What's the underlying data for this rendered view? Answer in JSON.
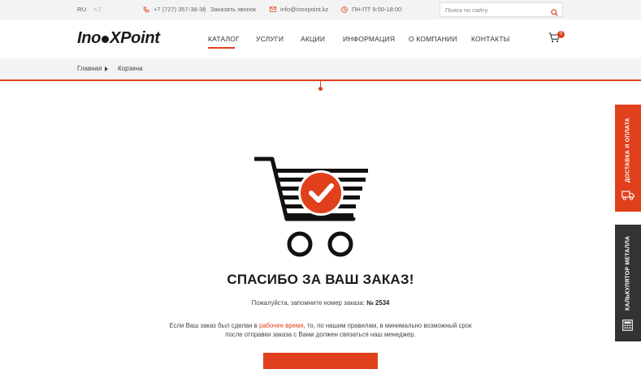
{
  "topbar": {
    "lang_current": "RU",
    "lang_other": "KZ",
    "phone": "+7 (727) 357-38-38",
    "callback": "Заказать звонок",
    "email": "info@inoxpoint.kz",
    "hours": "ПН-ПТ  9:00-18:00",
    "search_placeholder": "Поиск по сайту"
  },
  "header": {
    "logo_text_left": "Ino",
    "logo_text_right": "XPoint",
    "nav": [
      "КАТАЛОГ",
      "УСЛУГИ",
      "АКЦИИ",
      "ИНФОРМАЦИЯ",
      "О КОМПАНИИ",
      "КОНТАКТЫ"
    ],
    "active_nav_index": 0,
    "cart_count": "0"
  },
  "breadcrumb": {
    "home": "Главная",
    "current": "Корзина"
  },
  "main": {
    "title": "СПАСИБО ЗА ВАШ ЗАКАЗ!",
    "order_prefix": "Пожалуйста, запомните номер заказа:",
    "order_number": "№ 2534",
    "info_part1": "Если Ваш заказ был сделан в",
    "info_link": "рабочее время",
    "info_part2": ", то, по нашим правилам, в минимально возможный срок",
    "info_line2": "после отправки заказа с Вами должен связаться наш менеджер."
  },
  "side": {
    "delivery": "ДОСТАВКА И ОПЛАТА",
    "calculator": "КАЛЬКУЛЯТОР МЕТАЛЛА"
  },
  "colors": {
    "accent": "#e0401c",
    "dark": "#333333",
    "bar_bg": "#f3f3f3"
  },
  "icons": [
    "phone-icon",
    "mail-icon",
    "clock-icon",
    "search-icon",
    "cart-icon",
    "truck-icon",
    "calculator-icon",
    "checkmark-icon"
  ]
}
